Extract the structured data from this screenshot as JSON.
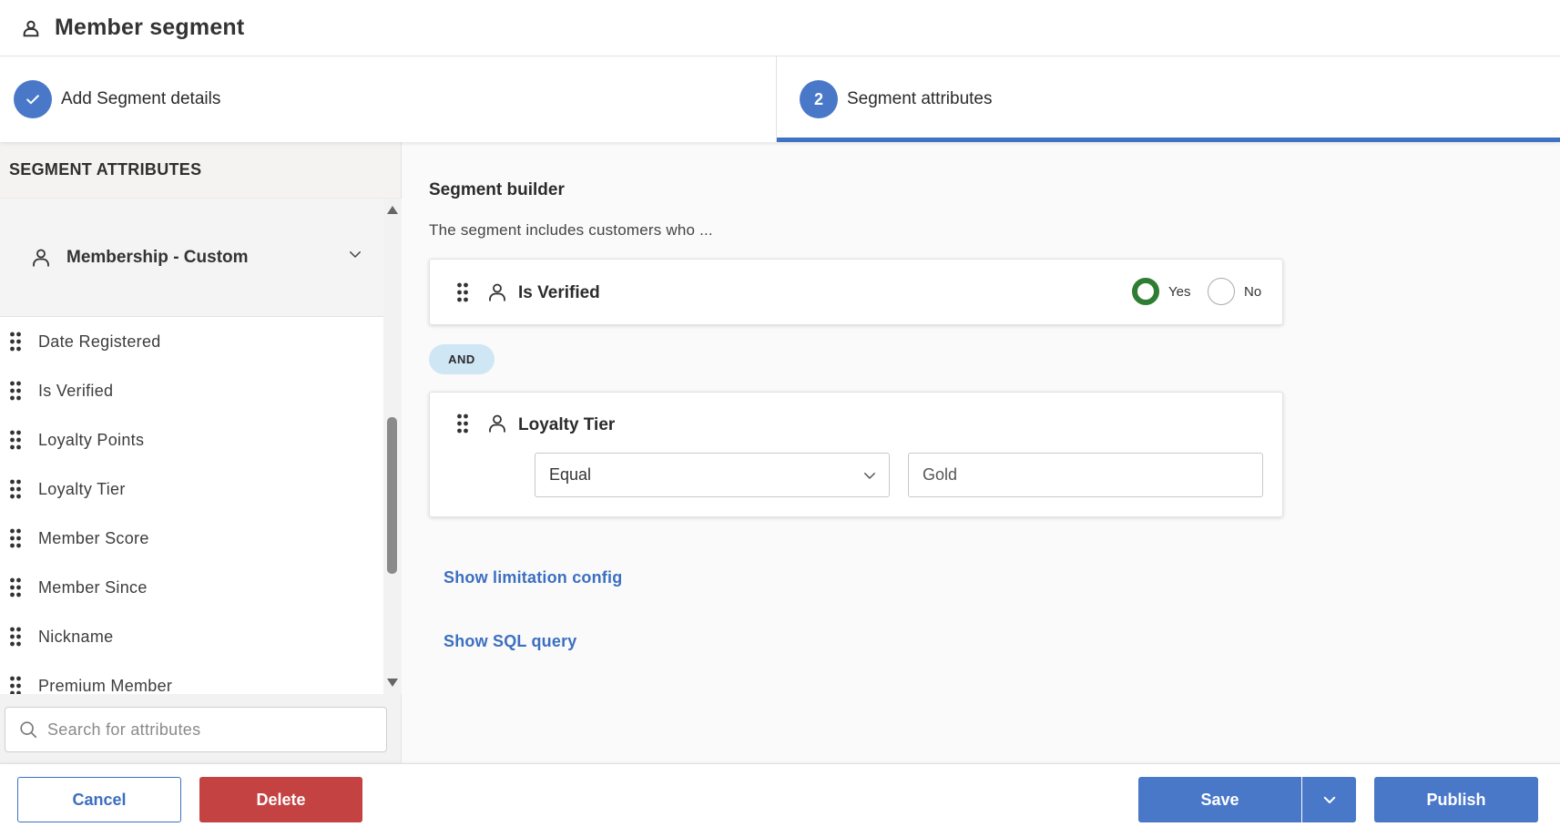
{
  "header": {
    "title": "Member segment",
    "icon": "person-icon"
  },
  "stepper": {
    "steps": [
      {
        "label": "Add Segment details",
        "state": "completed",
        "icon": "check-icon"
      },
      {
        "number": "2",
        "label": "Segment attributes",
        "state": "active"
      }
    ]
  },
  "sidebar": {
    "title": "SEGMENT ATTRIBUTES",
    "group": {
      "label": "Membership - Custom",
      "icon": "person-icon",
      "expanded": true
    },
    "attributes": [
      {
        "label": "Date Registered"
      },
      {
        "label": "Is Verified"
      },
      {
        "label": "Loyalty Points"
      },
      {
        "label": "Loyalty Tier"
      },
      {
        "label": "Member Score"
      },
      {
        "label": "Member Since"
      },
      {
        "label": "Nickname"
      },
      {
        "label": "Premium Member"
      }
    ],
    "search": {
      "placeholder": "Search for attributes",
      "value": ""
    }
  },
  "builder": {
    "title": "Segment builder",
    "description": "The segment includes customers who ...",
    "conditions": [
      {
        "title": "Is Verified",
        "type": "boolean",
        "options": [
          "Yes",
          "No"
        ],
        "selected": "Yes"
      },
      {
        "title": "Loyalty Tier",
        "operator": "Equal",
        "value": "Gold"
      }
    ],
    "connector": "AND",
    "links": {
      "limitation": "Show limitation config",
      "sql": "Show SQL query"
    }
  },
  "footer": {
    "cancel": "Cancel",
    "delete": "Delete",
    "save": "Save",
    "publish": "Publish"
  },
  "colors": {
    "primary": "#4a78c9",
    "danger": "#c44242",
    "radio_checked": "#2e7d32",
    "and_badge": "#cfe6f4",
    "link": "#3c6fc0"
  }
}
